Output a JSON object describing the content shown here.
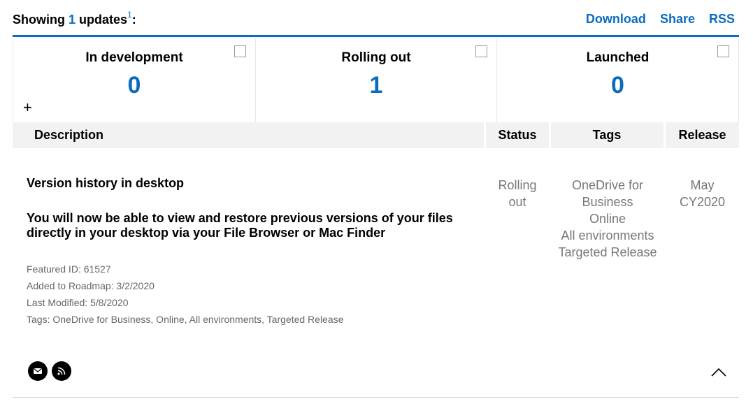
{
  "header": {
    "showing_prefix": "Showing",
    "count": "1",
    "showing_suffix": "updates",
    "footnote": "1",
    "colon": ":",
    "links": {
      "download": "Download",
      "share": "Share",
      "rss": "RSS"
    }
  },
  "stages": [
    {
      "title": "In development",
      "count": "0"
    },
    {
      "title": "Rolling out",
      "count": "1"
    },
    {
      "title": "Launched",
      "count": "0"
    }
  ],
  "expand_glyph": "+",
  "table": {
    "headers": {
      "description": "Description",
      "status": "Status",
      "tags": "Tags",
      "release": "Release"
    }
  },
  "feature": {
    "title": "Version history in desktop",
    "description": "You will now be able to view and restore previous versions of your files directly in your desktop via your File Browser or Mac Finder",
    "featured_id": "Featured ID: 61527",
    "added": "Added to Roadmap: 3/2/2020",
    "modified": "Last Modified: 5/8/2020",
    "tags_line": "Tags: OneDrive for Business, Online, All environments, Targeted Release",
    "status": [
      "Rolling",
      "out"
    ],
    "tags": [
      "OneDrive for",
      "Business",
      "Online",
      "All environments",
      "Targeted Release"
    ],
    "release": [
      "May",
      "CY2020"
    ]
  },
  "icons": {
    "email": "email-icon",
    "rss": "rss-icon",
    "collapse": "chevron-up-icon"
  },
  "colors": {
    "accent": "#0b6cbd",
    "header_bg": "#f2f2f2",
    "muted": "#777777"
  }
}
